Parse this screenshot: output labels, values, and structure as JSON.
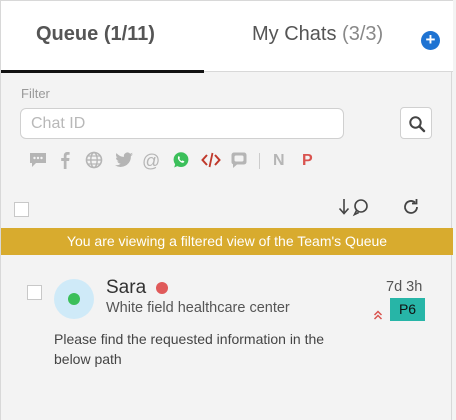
{
  "tabs": {
    "queue_label": "Queue",
    "queue_count": "(1/11)",
    "chats_label": "My Chats",
    "chats_count": "(3/3)",
    "add_symbol": "+"
  },
  "filter": {
    "label": "Filter",
    "placeholder": "Chat ID",
    "value": ""
  },
  "channels": [
    "chat-bubble-icon",
    "facebook-icon",
    "web-globe-icon",
    "twitter-icon",
    "at-email-icon",
    "whatsapp-icon",
    "code-icon",
    "message-square-icon",
    "N",
    "P"
  ],
  "channel_letters": {
    "n": "N",
    "p": "P"
  },
  "banner": "You are viewing a filtered view of the Team's Queue",
  "chat": {
    "name": "Sara",
    "organization": "White field healthcare center",
    "age": "7d 3h",
    "priority": "P6",
    "message": "Please find the requested information in the below path"
  },
  "colors": {
    "accent": "#1e73d2",
    "banner": "#d8ab2e",
    "whatsapp": "#3bbf5a",
    "code": "#c0392b",
    "p_letter": "#d9534f",
    "priority_badge": "#27b5a7",
    "status_offline": "#e05a5a"
  }
}
